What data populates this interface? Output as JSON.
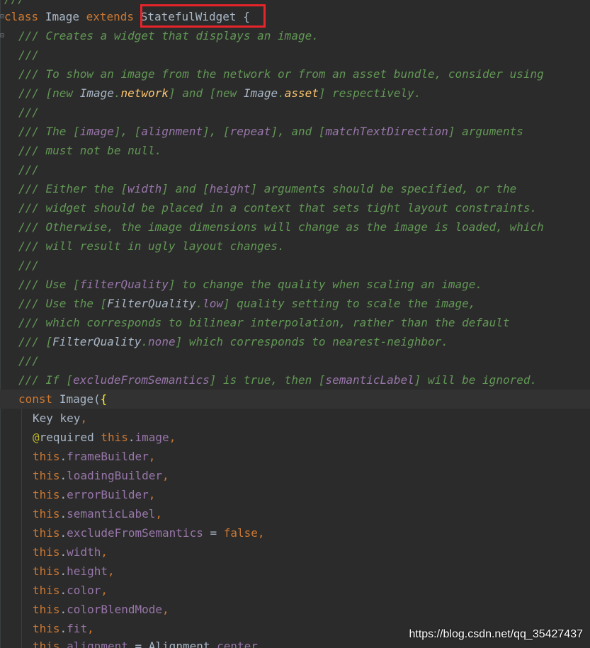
{
  "code": {
    "top_fragment": "///",
    "class_line": {
      "kw_class": "class",
      "name": "Image",
      "kw_extends": "extends",
      "parent": "StatefulWidget",
      "brace": "{"
    },
    "doc_lines": {
      "l1": "/// Creates a widget that displays an image.",
      "l2": "///",
      "l3": "/// To show an image from the network or from an asset bundle, consider using",
      "l4_a": "/// [new ",
      "l4_b": "Image",
      "l4_c": ".",
      "l4_d": "network",
      "l4_e": "] and [new ",
      "l4_f": "Image",
      "l4_g": ".",
      "l4_h": "asset",
      "l4_i": "] respectively.",
      "l5": "///",
      "l6_a": "/// The [",
      "l6_b": "image",
      "l6_c": "], [",
      "l6_d": "alignment",
      "l6_e": "], [",
      "l6_f": "repeat",
      "l6_g": "], and [",
      "l6_h": "matchTextDirection",
      "l6_i": "] arguments",
      "l7": "/// must not be null.",
      "l8": "///",
      "l9_a": "/// Either the [",
      "l9_b": "width",
      "l9_c": "] and [",
      "l9_d": "height",
      "l9_e": "] arguments should be specified, or the",
      "l10": "/// widget should be placed in a context that sets tight layout constraints.",
      "l11": "/// Otherwise, the image dimensions will change as the image is loaded, which",
      "l12": "/// will result in ugly layout changes.",
      "l13": "///",
      "l14_a": "/// Use [",
      "l14_b": "filterQuality",
      "l14_c": "] to change the quality when scaling an image.",
      "l15_a": "/// Use the [",
      "l15_b": "FilterQuality",
      "l15_c": ".",
      "l15_d": "low",
      "l15_e": "] quality setting to scale the image,",
      "l16": "/// which corresponds to bilinear interpolation, rather than the default",
      "l17_a": "/// [",
      "l17_b": "FilterQuality",
      "l17_c": ".",
      "l17_d": "none",
      "l17_e": "] which corresponds to nearest-neighbor.",
      "l18": "///",
      "l19_a": "/// If [",
      "l19_b": "excludeFromSemantics",
      "l19_c": "] is true, then [",
      "l19_d": "semanticLabel",
      "l19_e": "] will be ignored."
    },
    "ctor": {
      "kw_const": "const",
      "name": "Image(",
      "brace": "{",
      "key_type": "Key key",
      "key_comma": ",",
      "anno": "@",
      "anno_name": "required",
      "this_kw": "this",
      "dot": ".",
      "comma": ",",
      "f_image": "image",
      "f_frameBuilder": "frameBuilder",
      "f_loadingBuilder": "loadingBuilder",
      "f_errorBuilder": "errorBuilder",
      "f_semanticLabel": "semanticLabel",
      "f_excludeFromSemantics": "excludeFromSemantics",
      "eq": " = ",
      "false_kw": "false",
      "f_width": "width",
      "f_height": "height",
      "f_color": "color",
      "f_colorBlendMode": "colorBlendMode",
      "f_fit": "fit",
      "f_alignment": "alignment",
      "alignment_val_type": "Alignment",
      "alignment_val_field": "center"
    }
  },
  "watermark": "https://blog.csdn.net/qq_35427437",
  "colors": {
    "background": "#2b2b2b",
    "doc_comment": "#629755",
    "keyword": "#cc7832",
    "field": "#9876aa",
    "highlight_box": "#e8242b"
  }
}
